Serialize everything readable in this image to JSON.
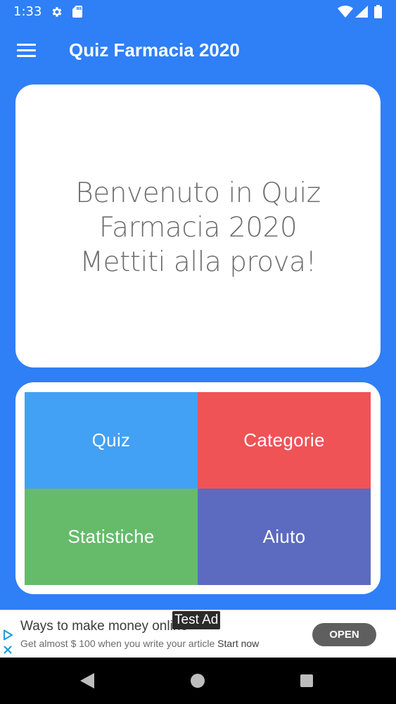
{
  "status_bar": {
    "time": "1:33",
    "icons": [
      "gear-icon",
      "sd-card-icon",
      "wifi-icon",
      "signal-icon",
      "battery-icon"
    ]
  },
  "app_bar": {
    "title": "Quiz Farmacia 2020",
    "menu_icon": "hamburger-menu-icon"
  },
  "welcome": {
    "lines": [
      "Benvenuto in Quiz",
      "Farmacia 2020",
      "Mettiti alla prova!"
    ]
  },
  "menu": {
    "tiles": [
      {
        "label": "Quiz",
        "color": "#42a0f5"
      },
      {
        "label": "Categorie",
        "color": "#ef5356"
      },
      {
        "label": "Statistiche",
        "color": "#66bb6b"
      },
      {
        "label": "Aiuto",
        "color": "#5c6bc0"
      }
    ]
  },
  "ad": {
    "badge": "Test Ad",
    "title": "Ways to make money online",
    "subtitle": "Get almost $ 100 when you write your article",
    "subtitle_link": "Start now",
    "open_label": "OPEN"
  },
  "nav_bar": {
    "icons": [
      "back-icon",
      "home-icon",
      "recents-icon"
    ]
  },
  "colors": {
    "primary": "#2f7ff6",
    "card": "#ffffff",
    "welcome_text": "#6e6e6e"
  }
}
